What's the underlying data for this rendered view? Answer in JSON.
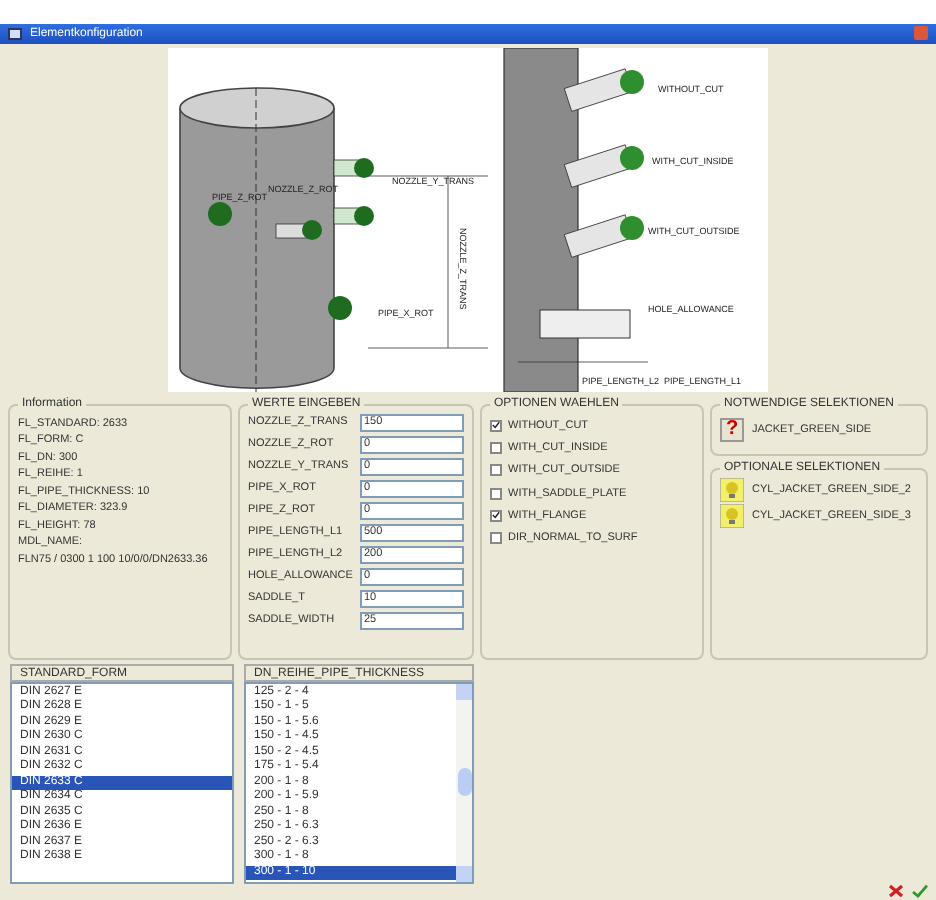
{
  "window": {
    "title": "Elementkonfiguration"
  },
  "diagram": {
    "labels": [
      "PIPE_Z_ROT",
      "NOZZLE_Z_ROT",
      "NOZZLE_Y_TRANS",
      "NOZZLE_Z_TRANS",
      "PIPE_X_ROT",
      "WITHOUT_CUT",
      "WITH_CUT_INSIDE",
      "WITH_CUT_OUTSIDE",
      "HOLE_ALLOWANCE",
      "PIPE_LENGTH_L2",
      "PIPE_LENGTH_L1"
    ]
  },
  "information": {
    "title": "Information",
    "lines": [
      "FL_STANDARD: 2633",
      "FL_FORM: C",
      "FL_DN: 300",
      "FL_REIHE: 1",
      "FL_PIPE_THICKNESS: 10",
      "FL_DIAMETER: 323.9",
      "FL_HEIGHT: 78",
      "MDL_NAME:",
      "FLN75 / 0300 1 100 10/0/0/DN2633.36"
    ]
  },
  "werte": {
    "title": "WERTE EINGEBEN",
    "fields": [
      {
        "label": "NOZZLE_Z_TRANS",
        "value": "150"
      },
      {
        "label": "NOZZLE_Z_ROT",
        "value": "0"
      },
      {
        "label": "NOZZLE_Y_TRANS",
        "value": "0"
      },
      {
        "label": "PIPE_X_ROT",
        "value": "0"
      },
      {
        "label": "PIPE_Z_ROT",
        "value": "0"
      },
      {
        "label": "PIPE_LENGTH_L1",
        "value": "500"
      },
      {
        "label": "PIPE_LENGTH_L2",
        "value": "200"
      },
      {
        "label": "HOLE_ALLOWANCE",
        "value": "0"
      },
      {
        "label": "SADDLE_T",
        "value": "10"
      },
      {
        "label": "SADDLE_WIDTH",
        "value": "25"
      }
    ]
  },
  "optionen": {
    "title": "OPTIONEN WAEHLEN",
    "options": [
      {
        "label": "WITHOUT_CUT",
        "checked": true
      },
      {
        "label": "WITH_CUT_INSIDE",
        "checked": false
      },
      {
        "label": "WITH_CUT_OUTSIDE",
        "checked": false
      },
      {
        "label": "WITH_SADDLE_PLATE",
        "checked": false
      },
      {
        "label": "WITH_FLANGE",
        "checked": true
      },
      {
        "label": "DIR_NORMAL_TO_SURF",
        "checked": false
      }
    ]
  },
  "notwendige": {
    "title": "NOTWENDIGE SELEKTIONEN",
    "items": [
      {
        "label": "JACKET_GREEN_SIDE",
        "kind": "required",
        "icon": "?"
      }
    ]
  },
  "optionale": {
    "title": "OPTIONALE SELEKTIONEN",
    "items": [
      {
        "label": "CYL_JACKET_GREEN_SIDE_2",
        "kind": "optional"
      },
      {
        "label": "CYL_JACKET_GREEN_SIDE_3",
        "kind": "optional"
      }
    ]
  },
  "standard_form": {
    "header": "STANDARD_FORM",
    "items": [
      {
        "label": "DIN 2627 E",
        "selected": false
      },
      {
        "label": "DIN 2628 E",
        "selected": false
      },
      {
        "label": "DIN 2629 E",
        "selected": false
      },
      {
        "label": "DIN 2630 C",
        "selected": false
      },
      {
        "label": "DIN 2631 C",
        "selected": false
      },
      {
        "label": "DIN 2632 C",
        "selected": false
      },
      {
        "label": "DIN 2633 C",
        "selected": true
      },
      {
        "label": "DIN 2634 C",
        "selected": false
      },
      {
        "label": "DIN 2635 C",
        "selected": false
      },
      {
        "label": "DIN 2636 E",
        "selected": false
      },
      {
        "label": "DIN 2637 E",
        "selected": false
      },
      {
        "label": "DIN 2638 E",
        "selected": false
      }
    ]
  },
  "dn_reihe": {
    "header": "DN_REIHE_PIPE_THICKNESS",
    "items": [
      {
        "label": "125 - 2 - 4",
        "selected": false
      },
      {
        "label": "150 - 1 - 5",
        "selected": false
      },
      {
        "label": "150 - 1 - 5.6",
        "selected": false
      },
      {
        "label": "150 - 1 - 4.5",
        "selected": false
      },
      {
        "label": "150 - 2 - 4.5",
        "selected": false
      },
      {
        "label": "175 - 1 - 5.4",
        "selected": false
      },
      {
        "label": "200 - 1 - 8",
        "selected": false
      },
      {
        "label": "200 - 1 - 5.9",
        "selected": false
      },
      {
        "label": "250 - 1 - 8",
        "selected": false
      },
      {
        "label": "250 - 1 - 6.3",
        "selected": false
      },
      {
        "label": "250 - 2 - 6.3",
        "selected": false
      },
      {
        "label": "300 - 1 - 8",
        "selected": false
      },
      {
        "label": "300 - 1 - 10",
        "selected": true
      }
    ]
  }
}
